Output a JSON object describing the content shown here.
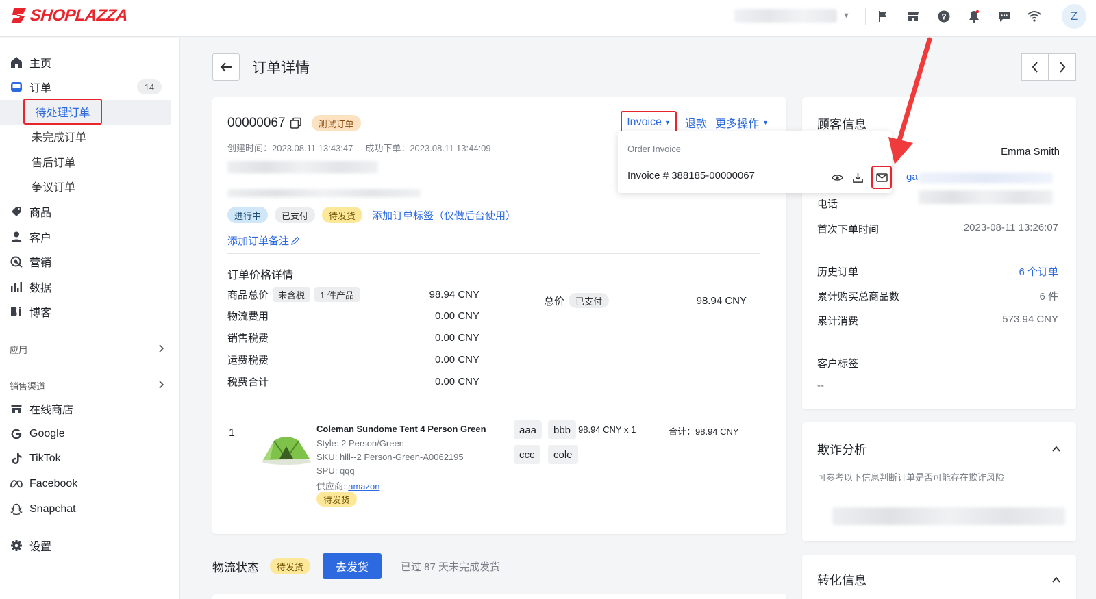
{
  "brand": {
    "name": "SHOPLAZZA",
    "accent": "#e8242c"
  },
  "topbar": {
    "avatar_initial": "Z",
    "icons": [
      "flag-icon",
      "store-icon",
      "help-icon",
      "bell-icon",
      "chat-icon",
      "wifi-icon"
    ]
  },
  "sidebar": {
    "items": [
      {
        "label": "主页",
        "icon": "home-icon"
      },
      {
        "label": "订单",
        "icon": "inbox-icon",
        "badge": "14"
      },
      {
        "label": "商品",
        "icon": "tag-icon"
      },
      {
        "label": "客户",
        "icon": "user-icon"
      },
      {
        "label": "营销",
        "icon": "target-icon"
      },
      {
        "label": "数据",
        "icon": "bar-chart-icon"
      },
      {
        "label": "博客",
        "icon": "blog-icon"
      }
    ],
    "order_sub": [
      "待处理订单",
      "未完成订单",
      "售后订单",
      "争议订单"
    ],
    "section_apps": "应用",
    "section_channels": "销售渠道",
    "channels": [
      {
        "label": "在线商店",
        "icon": "store-icon"
      },
      {
        "label": "Google",
        "icon": "google-icon"
      },
      {
        "label": "TikTok",
        "icon": "tiktok-icon"
      },
      {
        "label": "Facebook",
        "icon": "meta-icon"
      },
      {
        "label": "Snapchat",
        "icon": "snapchat-icon"
      }
    ],
    "settings": "设置"
  },
  "page": {
    "title": "订单详情"
  },
  "order": {
    "number": "00000067",
    "test_tag": "测试订单",
    "created_label": "创建时间：2023.08.11 13:43:47",
    "success_label": "成功下单：2023.08.11 13:44:09",
    "status_tags": [
      "进行中",
      "已支付",
      "待发货"
    ],
    "add_tag_link": "添加订单标签（仅做后台使用）",
    "add_note_link": "添加订单备注",
    "actions": {
      "invoice": "Invoice",
      "refund": "退款",
      "more": "更多操作"
    }
  },
  "invoice_dropdown": {
    "header": "Order Invoice",
    "item": "Invoice # 388185-00000067"
  },
  "price": {
    "title": "订单价格详情",
    "rows": [
      {
        "label": "商品总价",
        "value": "98.94 CNY"
      },
      {
        "label": "物流费用",
        "value": "0.00 CNY"
      },
      {
        "label": "销售税费",
        "value": "0.00 CNY"
      },
      {
        "label": "运费税费",
        "value": "0.00 CNY"
      },
      {
        "label": "税费合计",
        "value": "0.00 CNY"
      }
    ],
    "tax_tag": "未含税",
    "qty_tag": "1 件产品",
    "total_label": "总价",
    "total_tag": "已支付",
    "total_value": "98.94 CNY"
  },
  "line_item": {
    "index": "1",
    "title": "Coleman Sundome Tent 4 Person Green",
    "style": "Style: 2 Person/Green",
    "sku": "SKU: hill--2 Person-Green-A0062195",
    "spu": "SPU: qqq",
    "supplier_label": "供应商: ",
    "supplier_link": "amazon",
    "status": "待发货",
    "chips": [
      "aaa",
      "bbb",
      "ccc",
      "cole"
    ],
    "price": "98.94 CNY x 1",
    "total": "合计：98.94 CNY"
  },
  "shipping": {
    "title": "物流状态",
    "tag": "待发货",
    "button": "去发货",
    "note": "已过 87 天未完成发货"
  },
  "customer": {
    "title": "顾客信息",
    "name": "Emma Smith",
    "email_fragment": "ga",
    "phone_label": "电话",
    "first_order_label": "首次下单时间",
    "first_order_value": "2023-08-11 13:26:07",
    "history_label": "历史订单",
    "history_value": "6 个订单",
    "items_label": "累计购买总商品数",
    "items_value": "6 件",
    "spent_label": "累计消费",
    "spent_value": "573.94 CNY",
    "tags_label": "客户标签",
    "tags_value": "--"
  },
  "fraud": {
    "title": "欺诈分析",
    "desc": "可参考以下信息判断订单是否可能存在欺诈风险"
  },
  "conversion": {
    "title": "转化信息"
  }
}
